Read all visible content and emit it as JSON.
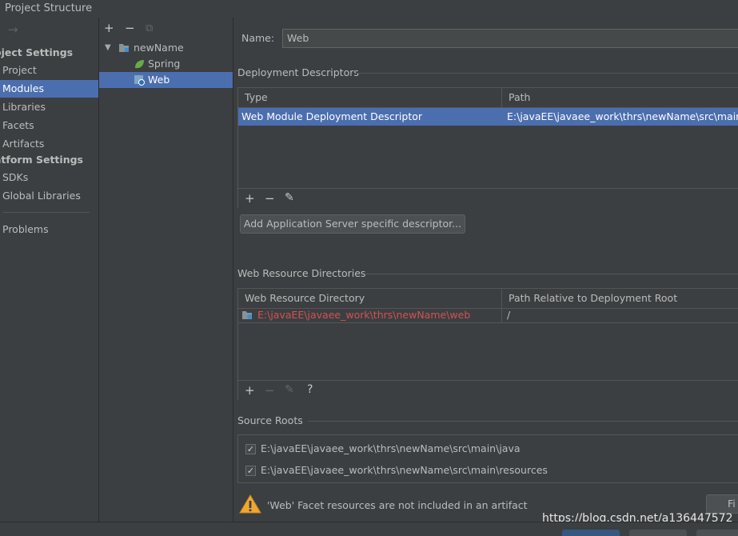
{
  "window": {
    "title": "Project Structure"
  },
  "nav": {
    "back_arrow": "→",
    "project_settings_header": "oject Settings",
    "project_items": [
      "Project",
      "Modules",
      "Libraries",
      "Facets",
      "Artifacts"
    ],
    "platform_settings_header": "atform Settings",
    "platform_items": [
      "SDKs",
      "Global Libraries"
    ],
    "problems": "Problems",
    "selected": "Modules"
  },
  "tree": {
    "toolbar": {
      "add": "+",
      "remove": "−",
      "copy": "⧉"
    },
    "root": "newName",
    "children": [
      "Spring",
      "Web"
    ],
    "selected": "Web"
  },
  "facet": {
    "name_label": "Name:",
    "name_value": "Web"
  },
  "deployment": {
    "title": "Deployment Descriptors",
    "columns": [
      "Type",
      "Path"
    ],
    "rows": [
      {
        "type": "Web Module Deployment Descriptor",
        "path": "E:\\javaEE\\javaee_work\\thrs\\newName\\src\\main\\we"
      }
    ],
    "toolbar": {
      "add": "+",
      "remove": "−",
      "edit": "✎"
    },
    "add_server_button": "Add Application Server specific descriptor..."
  },
  "web_resources": {
    "title": "Web Resource Directories",
    "columns": [
      "Web Resource Directory",
      "Path Relative to Deployment Root"
    ],
    "rows": [
      {
        "directory": "E:\\javaEE\\javaee_work\\thrs\\newName\\web",
        "relative": "/"
      }
    ],
    "toolbar": {
      "add": "+",
      "remove": "−",
      "edit": "✎",
      "help": "?"
    }
  },
  "source_roots": {
    "title": "Source Roots",
    "items": [
      {
        "path": "E:\\javaEE\\javaee_work\\thrs\\newName\\src\\main\\java",
        "checked": true
      },
      {
        "path": "E:\\javaEE\\javaee_work\\thrs\\newName\\src\\main\\resources",
        "checked": true
      }
    ]
  },
  "warning": {
    "icon": "warning-icon",
    "text": "'Web' Facet resources are not included in an artifact",
    "fix_button": "Fi"
  },
  "watermark": "https://blog.csdn.net/a136447572",
  "colors": {
    "background": "#3c3f41",
    "selection": "#4b6eaf",
    "error_path": "#d25252",
    "warning": "#f0a732",
    "spring_green": "#6aab45"
  }
}
